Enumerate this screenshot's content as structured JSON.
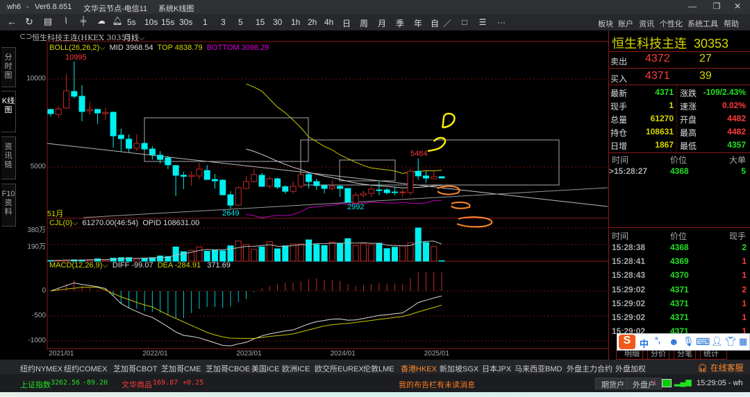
{
  "titlebar": {
    "app": "wh6",
    "sep": "-",
    "version": "Ver6.8.651",
    "server": "文华云节点-电信11",
    "view": "系统K线图",
    "min": "—",
    "max": "❐",
    "close": "✕"
  },
  "toolbar": {
    "icons": [
      "back-icon",
      "refresh-icon",
      "table-icon",
      "line-chart-icon",
      "candle-icon",
      "cloud-icon",
      "bell-icon"
    ],
    "periods": [
      "5s",
      "10s",
      "15s",
      "30s",
      "1",
      "3",
      "5",
      "15",
      "30",
      "1h",
      "2h",
      "4h",
      "日",
      "周",
      "月",
      "季",
      "年",
      "自"
    ],
    "draw_tools": [
      "／",
      "□",
      "☰",
      "···"
    ],
    "menu": [
      "板块",
      "账户",
      "资讯",
      "个性化",
      "系统工具",
      "帮助"
    ]
  },
  "symbol": {
    "header": "恒生科技主连(HKEX 30353)",
    "period": "月线"
  },
  "side_tabs": [
    "分时图",
    "K线图",
    "资讯链",
    "F10资料"
  ],
  "legend": {
    "boll_name": "BOLL(26,26,2)",
    "mid": "MID 3968.54",
    "top": "TOP 4838.79",
    "bottom": "BOTTOM 3098.29",
    "cjl_name": "CJL(0)",
    "cjl_val": "61270.00(46:54)",
    "opid": "OPID 108631.00",
    "macd_name": "MACD(12,26,9)",
    "diff": "DIFF -99.07",
    "dea": "DEA -284.91",
    "macd_val": "371.69"
  },
  "annotations": {
    "high": "10995",
    "low1": "2649",
    "low2": "2992",
    "high2": "5484",
    "count": "51月"
  },
  "axes": {
    "price": [
      "10000",
      "5000"
    ],
    "volume": [
      "380万",
      "190万"
    ],
    "macd": [
      "0",
      "-500",
      "-1000"
    ]
  },
  "colors": {
    "up": "#c42a2a",
    "down": "#00f0f0",
    "boll_mid": "#cfcfcf",
    "boll_top": "#c8c800",
    "boll_bottom": "#c000c0",
    "grid": "#7a1010"
  },
  "chart_data": {
    "type": "candlestick",
    "x_labels": [
      {
        "label": "2021/01",
        "index": 1
      },
      {
        "label": "2022/01",
        "index": 13
      },
      {
        "label": "2023/01",
        "index": 25
      },
      {
        "label": "2024/01",
        "index": 37
      },
      {
        "label": "2025/01",
        "index": 49
      }
    ],
    "ohlc": [
      [
        8270,
        8300,
        7870,
        8030
      ],
      [
        7990,
        8460,
        7770,
        8300
      ],
      [
        8350,
        10270,
        8300,
        9330
      ],
      [
        9290,
        10995,
        8900,
        9020
      ],
      [
        9020,
        9650,
        7600,
        8150
      ],
      [
        8190,
        8700,
        7950,
        8270
      ],
      [
        8270,
        8300,
        7440,
        8070
      ],
      [
        8030,
        8350,
        7670,
        8100
      ],
      [
        8110,
        8150,
        6100,
        6770
      ],
      [
        6810,
        7180,
        5850,
        6610
      ],
      [
        6580,
        6850,
        5800,
        6060
      ],
      [
        6060,
        6850,
        5900,
        6340
      ],
      [
        6340,
        6420,
        5950,
        6020
      ],
      [
        6020,
        6180,
        5420,
        5700
      ],
      [
        5670,
        5900,
        5190,
        5430
      ],
      [
        5510,
        5630,
        4880,
        5120
      ],
      [
        5080,
        5120,
        3350,
        4530
      ],
      [
        4530,
        4730,
        3740,
        4470
      ],
      [
        4460,
        4760,
        3930,
        4530
      ],
      [
        4490,
        5230,
        4300,
        4880
      ],
      [
        4800,
        5100,
        4270,
        4290
      ],
      [
        4290,
        4600,
        3780,
        4210
      ],
      [
        4250,
        4300,
        3380,
        3420
      ],
      [
        3420,
        3620,
        2649,
        2830
      ],
      [
        2830,
        3900,
        2800,
        3820
      ],
      [
        3780,
        4500,
        3750,
        4170
      ],
      [
        4170,
        4900,
        4120,
        4570
      ],
      [
        4530,
        4650,
        3860,
        3900
      ],
      [
        3900,
        4460,
        3770,
        4330
      ],
      [
        4330,
        4400,
        3750,
        3860
      ],
      [
        3880,
        3960,
        3470,
        3620
      ],
      [
        3620,
        4200,
        3470,
        3900
      ],
      [
        3900,
        4650,
        3780,
        4570
      ],
      [
        4570,
        4680,
        3780,
        4170
      ],
      [
        4170,
        4330,
        3700,
        3940
      ],
      [
        3940,
        4020,
        3500,
        3780
      ],
      [
        3780,
        4250,
        3660,
        3900
      ],
      [
        3900,
        3960,
        3300,
        3780
      ],
      [
        3780,
        3800,
        2992,
        3000
      ],
      [
        2950,
        3550,
        2950,
        3400
      ],
      [
        3400,
        3660,
        3270,
        3500
      ],
      [
        3500,
        3900,
        3270,
        3740
      ],
      [
        3700,
        4200,
        3400,
        3660
      ],
      [
        3700,
        3800,
        3440,
        3540
      ],
      [
        3580,
        3850,
        3400,
        3540
      ],
      [
        3540,
        3700,
        3300,
        3580
      ],
      [
        3540,
        4900,
        3400,
        4760
      ],
      [
        4760,
        5484,
        4270,
        4490
      ],
      [
        4490,
        4760,
        4100,
        4370
      ],
      [
        4330,
        4760,
        4330,
        4450
      ],
      [
        4450,
        4450,
        4357,
        4371
      ]
    ],
    "volume_wan": [
      8,
      11,
      14,
      16,
      14,
      19,
      27,
      14,
      35,
      41,
      41,
      27,
      35,
      41,
      60,
      54,
      163,
      109,
      125,
      163,
      114,
      130,
      119,
      176,
      231,
      190,
      136,
      163,
      223,
      141,
      176,
      198,
      198,
      244,
      190,
      179,
      217,
      201,
      258,
      179,
      198,
      190,
      206,
      144,
      160,
      176,
      209,
      380,
      214,
      168,
      6
    ],
    "diff": [
      0,
      55,
      110,
      162,
      130,
      110,
      85,
      50,
      -100,
      -250,
      -340,
      -410,
      -480,
      -530,
      -620,
      -720,
      -820,
      -890,
      -910,
      -940,
      -990,
      -1040,
      -1090,
      -1100,
      -1060,
      -1030,
      -960,
      -900,
      -860,
      -830,
      -800,
      -780,
      -720,
      -660,
      -615,
      -590,
      -565,
      -560,
      -585,
      -580,
      -550,
      -520,
      -490,
      -475,
      -455,
      -440,
      -340,
      -231,
      -185,
      -140,
      -99.07
    ],
    "dea": [
      0,
      20,
      40,
      55,
      75,
      78,
      72,
      20,
      -50,
      -120,
      -170,
      -230,
      -280,
      -320,
      -400,
      -480,
      -550,
      -620,
      -690,
      -760,
      -830,
      -880,
      -920,
      -945,
      -950,
      -950,
      -950,
      -930,
      -910,
      -895,
      -880,
      -860,
      -820,
      -780,
      -740,
      -700,
      -675,
      -660,
      -650,
      -630,
      -610,
      -590,
      -570,
      -550,
      -530,
      -510,
      -470,
      -420,
      -375,
      -330,
      -284.91
    ],
    "price_range": [
      2100,
      11900
    ],
    "boll_period": 26
  },
  "quote": {
    "title": "恒生科技主连",
    "code": "30353",
    "ask_label": "卖出",
    "ask": "4372",
    "ask_vol": "27",
    "bid_label": "买入",
    "bid": "4371",
    "bid_vol": "39",
    "stats": [
      {
        "l": "最新",
        "v": "4371",
        "vc": "g",
        "l2": "涨跌",
        "v2": "-109/2.43%",
        "v2c": "g"
      },
      {
        "l": "现手",
        "v": "1",
        "vc": "y",
        "l2": "速涨",
        "v2": "0.02%",
        "v2c": "r"
      },
      {
        "l": "总量",
        "v": "61270",
        "vc": "y",
        "l2": "开盘",
        "v2": "4482",
        "v2c": "r"
      },
      {
        "l": "持仓",
        "v": "108631",
        "vc": "y",
        "l2": "最高",
        "v2": "4482",
        "v2c": "r"
      },
      {
        "l": "日增",
        "v": "1867",
        "vc": "y",
        "l2": "最低",
        "v2": "4357",
        "v2c": "g"
      }
    ],
    "big_header": [
      "时间",
      "价位",
      "大单"
    ],
    "big_row": {
      "time": ">15:28:27",
      "price": "4368",
      "qty": "5"
    },
    "tick_header": [
      "时间",
      "价位",
      "现手"
    ],
    "ticks": [
      {
        "t": "15:28:38",
        "p": "4368",
        "q": "2",
        "qc": "g"
      },
      {
        "t": "15:28:41",
        "p": "4369",
        "q": "1",
        "qc": "r"
      },
      {
        "t": "15:28:43",
        "p": "4370",
        "q": "1",
        "qc": "r"
      },
      {
        "t": "15:29:02",
        "p": "4371",
        "q": "2",
        "qc": "r"
      },
      {
        "t": "15:29:02",
        "p": "4371",
        "q": "1",
        "qc": "r"
      },
      {
        "t": "15:29:02",
        "p": "4371",
        "q": "1",
        "qc": "r"
      },
      {
        "t": "15:29:02",
        "p": "4371",
        "q": "1",
        "qc": "r"
      }
    ],
    "tabs": [
      "明细",
      "分价",
      "分笔",
      "统计"
    ]
  },
  "ime": {
    "logo": "S",
    "lang": "中",
    "punct": "°,"
  },
  "markets": [
    "纽约NYMEX",
    "纽约COMEX",
    "芝加哥CBOT",
    "芝加哥CME",
    "芝加哥CBOE",
    "美国ICE",
    "欧洲ICE",
    "欧交所EUREX",
    "伦敦LME",
    "香港HKEX",
    "新加坡SGX",
    "日本JPX",
    "马来西亚BMD",
    "外盘主力合约",
    "外盘加权"
  ],
  "active_market": "香港HKEX",
  "support": "在线客服",
  "status": {
    "idx1_name": "上证指数",
    "idx1_val": "3262.56",
    "idx1_chg": "-89.20",
    "idx2_name": "文华商品",
    "idx2_val": "169.87",
    "idx2_chg": "+0.25",
    "notice": "我的布告栏有未读消息",
    "btn1": "期货户",
    "btn2": "外盘户",
    "sep": "\\",
    "clock": "15:29:05 - wh"
  }
}
